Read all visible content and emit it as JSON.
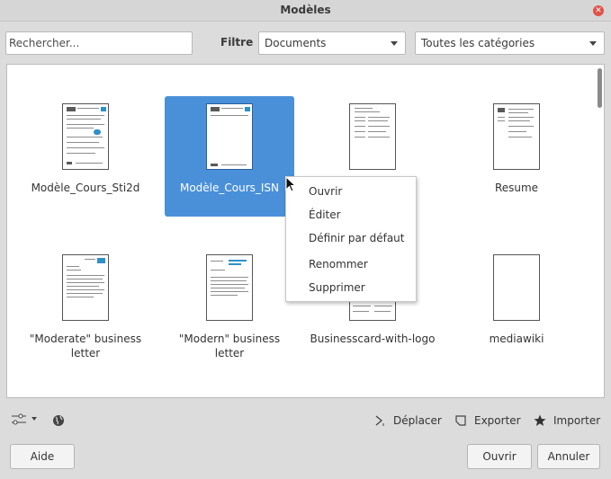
{
  "window": {
    "title": "Modèles"
  },
  "search": {
    "placeholder": "Rechercher..."
  },
  "filter": {
    "label": "Filtre",
    "type_selected": "Documents",
    "category_selected": "Toutes les catégories"
  },
  "templates": [
    {
      "name": "Modèle_Cours_Sti2d",
      "selected": false
    },
    {
      "name": "Modèle_Cours_ISN",
      "selected": true
    },
    {
      "name": "",
      "selected": false
    },
    {
      "name": "Resume",
      "selected": false
    },
    {
      "name": "\"Moderate\" business letter",
      "selected": false
    },
    {
      "name": "\"Modern\" business letter",
      "selected": false
    },
    {
      "name": "Businesscard-with-logo",
      "selected": false
    },
    {
      "name": "mediawiki",
      "selected": false
    }
  ],
  "context_menu": {
    "items": [
      "Ouvrir",
      "Éditer",
      "Définir par défaut",
      "Renommer",
      "Supprimer"
    ]
  },
  "toolbar": {
    "settings_icon": "settings-sliders-icon",
    "online_icon": "globe-icon",
    "move_label": "Déplacer",
    "export_label": "Exporter",
    "import_label": "Importer"
  },
  "buttons": {
    "help": "Aide",
    "open": "Ouvrir",
    "cancel": "Annuler"
  },
  "colors": {
    "selection": "#4a90d9",
    "close": "#e0524a",
    "accent": "#2e90c8"
  }
}
